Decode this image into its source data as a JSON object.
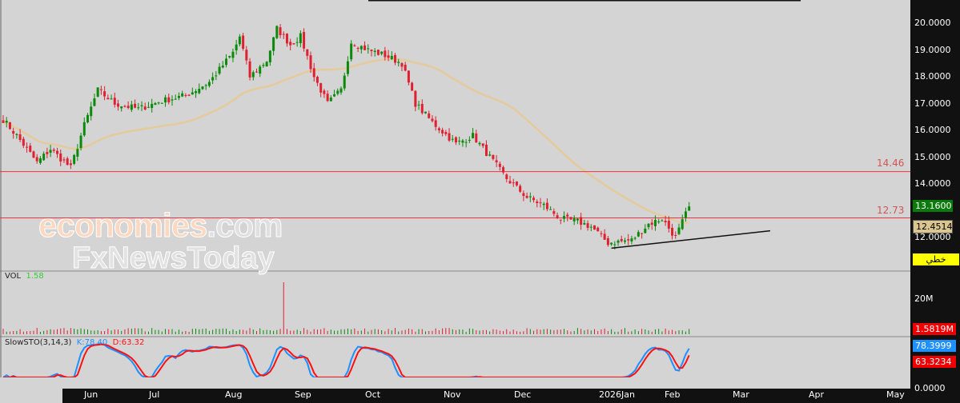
{
  "price_axis": {
    "ticks": [
      "20.0000",
      "19.0000",
      "18.0000",
      "17.0000",
      "16.0000",
      "15.0000",
      "14.0000",
      "12.0000"
    ],
    "tick_values": [
      20,
      19,
      18,
      17,
      16,
      15,
      14,
      12
    ]
  },
  "badges": {
    "last_price": "13.1600",
    "ma_value": "12.4514",
    "line_tool": "خطي",
    "volume": "1.5819M",
    "stoch_k": "78.3999",
    "stoch_d": "63.3234"
  },
  "volume_axis": {
    "tick": "20M"
  },
  "stoch_axis": {
    "tick": "0.0000"
  },
  "levels": [
    {
      "label": "14.46",
      "value": 14.46
    },
    {
      "label": "12.73",
      "value": 12.73
    }
  ],
  "volume_label": {
    "name": "VOL",
    "value": "1.58"
  },
  "stoch_label": {
    "name": "SlowSTO(3,14,3)",
    "k": "K:78.40",
    "d": "D:63.32"
  },
  "watermark": {
    "line1a": "economies",
    "line1b": ".com",
    "line2": "FxNewsToday"
  },
  "time_axis": [
    "Jun",
    "Jul",
    "Aug",
    "Sep",
    "Oct",
    "Nov",
    "Dec",
    "2026Jan",
    "Feb",
    "Mar",
    "Apr",
    "May"
  ],
  "colors": {
    "up": "#0a8a0a",
    "down": "#e02030",
    "ma": "#e8c890",
    "level": "#ee3344",
    "k": "#1e90ff",
    "d": "#ff1010"
  },
  "chart_data": {
    "type": "candlestick",
    "price_path": [
      [
        0,
        16.4
      ],
      [
        4,
        15.8
      ],
      [
        10,
        14.8
      ],
      [
        14,
        15.3
      ],
      [
        20,
        14.6
      ],
      [
        24,
        16.2
      ],
      [
        28,
        17.5
      ],
      [
        33,
        17.0
      ],
      [
        40,
        16.8
      ],
      [
        47,
        17.1
      ],
      [
        54,
        17.3
      ],
      [
        61,
        17.8
      ],
      [
        68,
        18.9
      ],
      [
        70,
        19.5
      ],
      [
        73,
        18.0
      ],
      [
        78,
        18.6
      ],
      [
        81,
        19.8
      ],
      [
        85,
        19.2
      ],
      [
        88,
        19.5
      ],
      [
        92,
        18.0
      ],
      [
        96,
        17.0
      ],
      [
        100,
        17.5
      ],
      [
        103,
        19.3
      ],
      [
        108,
        19.0
      ],
      [
        113,
        18.8
      ],
      [
        118,
        18.5
      ],
      [
        122,
        17.0
      ],
      [
        127,
        16.3
      ],
      [
        134,
        15.5
      ],
      [
        139,
        15.8
      ],
      [
        144,
        15.0
      ],
      [
        149,
        14.2
      ],
      [
        155,
        13.5
      ],
      [
        160,
        13.2
      ],
      [
        165,
        12.7
      ],
      [
        170,
        12.6
      ],
      [
        174,
        12.4
      ],
      [
        179,
        11.8
      ],
      [
        186,
        11.9
      ],
      [
        191,
        12.5
      ],
      [
        195,
        12.7
      ],
      [
        199,
        12.0
      ],
      [
        203,
        13.16
      ]
    ],
    "ma_period": 50,
    "volume_spike_index": 83,
    "levels": [
      14.46,
      12.73
    ],
    "trendline": [
      [
        180,
        11.6
      ],
      [
        227,
        12.25
      ]
    ],
    "y_range": [
      11.5,
      20.5
    ]
  }
}
